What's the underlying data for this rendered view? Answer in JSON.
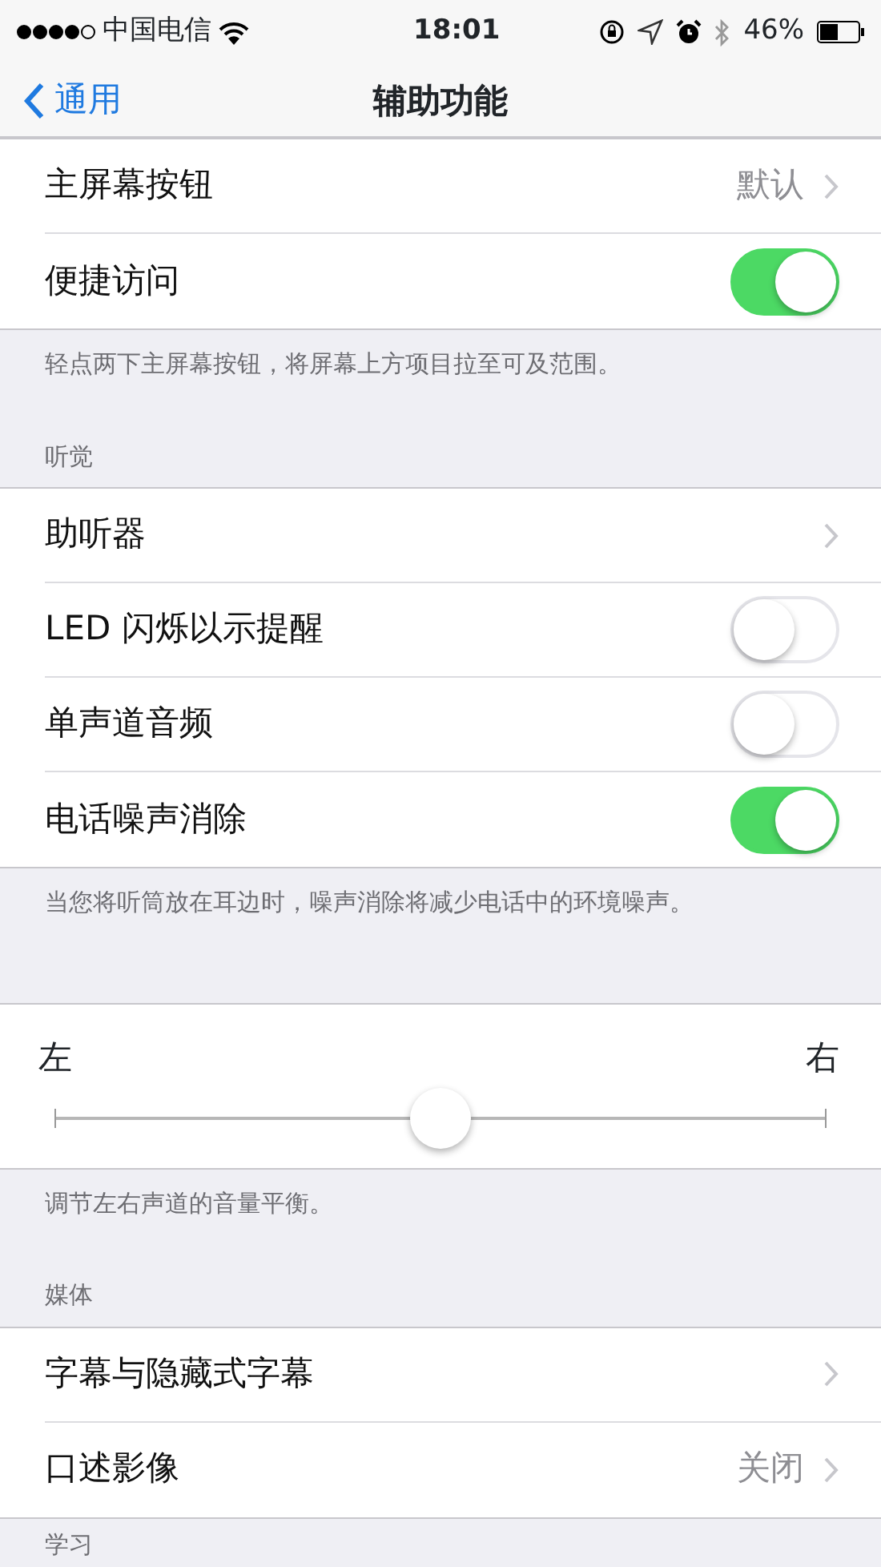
{
  "status_bar": {
    "carrier": "中国电信",
    "time": "18:01",
    "battery": "46%"
  },
  "nav": {
    "back": "通用",
    "title": "辅助功能"
  },
  "groups": [
    {
      "items": [
        {
          "kind": "disclosure",
          "label": "主屏幕按钮",
          "value": "默认"
        },
        {
          "kind": "toggle",
          "label": "便捷访问",
          "on": true
        }
      ],
      "footer": "轻点两下主屏幕按钮，将屏幕上方项目拉至可及范围。"
    },
    {
      "header": "听觉",
      "items": [
        {
          "kind": "disclosure",
          "label": "助听器"
        },
        {
          "kind": "toggle",
          "label": "LED 闪烁以示提醒",
          "on": false
        },
        {
          "kind": "toggle",
          "label": "单声道音频",
          "on": false
        },
        {
          "kind": "toggle",
          "label": "电话噪声消除",
          "on": true
        }
      ],
      "footer": "当您将听筒放在耳边时，噪声消除将减少电话中的环境噪声。"
    },
    {
      "items": [
        {
          "kind": "balance",
          "left": "左",
          "right": "右",
          "level": 0.5
        }
      ],
      "footer": "调节左右声道的音量平衡。"
    },
    {
      "header": "媒体",
      "items": [
        {
          "kind": "disclosure",
          "label": "字幕与隐藏式字幕"
        },
        {
          "kind": "disclosure",
          "label": "口述影像",
          "value": "关闭"
        }
      ]
    },
    {
      "header": "学习"
    }
  ]
}
